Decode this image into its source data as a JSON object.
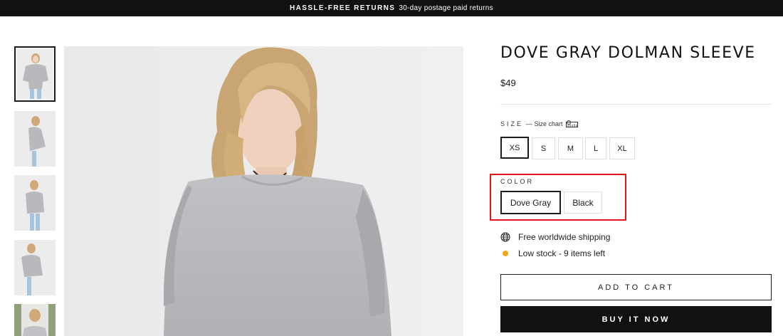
{
  "announcement": {
    "strong": "HASSLE-FREE RETURNS",
    "text": "30-day postage paid returns"
  },
  "product": {
    "title": "DOVE GRAY DOLMAN SLEEVE",
    "price": "$49",
    "size_label": "SIZE",
    "size_chart": "— Size chart",
    "sizes": [
      "XS",
      "S",
      "M",
      "L",
      "XL"
    ],
    "selected_size": "XS",
    "color_label": "COLOR",
    "colors": [
      "Dove Gray",
      "Black"
    ],
    "selected_color": "Dove Gray"
  },
  "features": [
    {
      "icon": "globe-icon",
      "text": "Free worldwide shipping"
    },
    {
      "icon": "stock-dot-icon",
      "text": "Low stock - 9 items left"
    }
  ],
  "actions": {
    "add_to_cart": "ADD TO CART",
    "buy_now": "BUY IT NOW"
  },
  "colors": {
    "accent": "#111111",
    "highlight": "#e3131b",
    "stock_dot": "#f0a818",
    "shirt": "#b9b8bc",
    "hair": "#c9a878"
  }
}
